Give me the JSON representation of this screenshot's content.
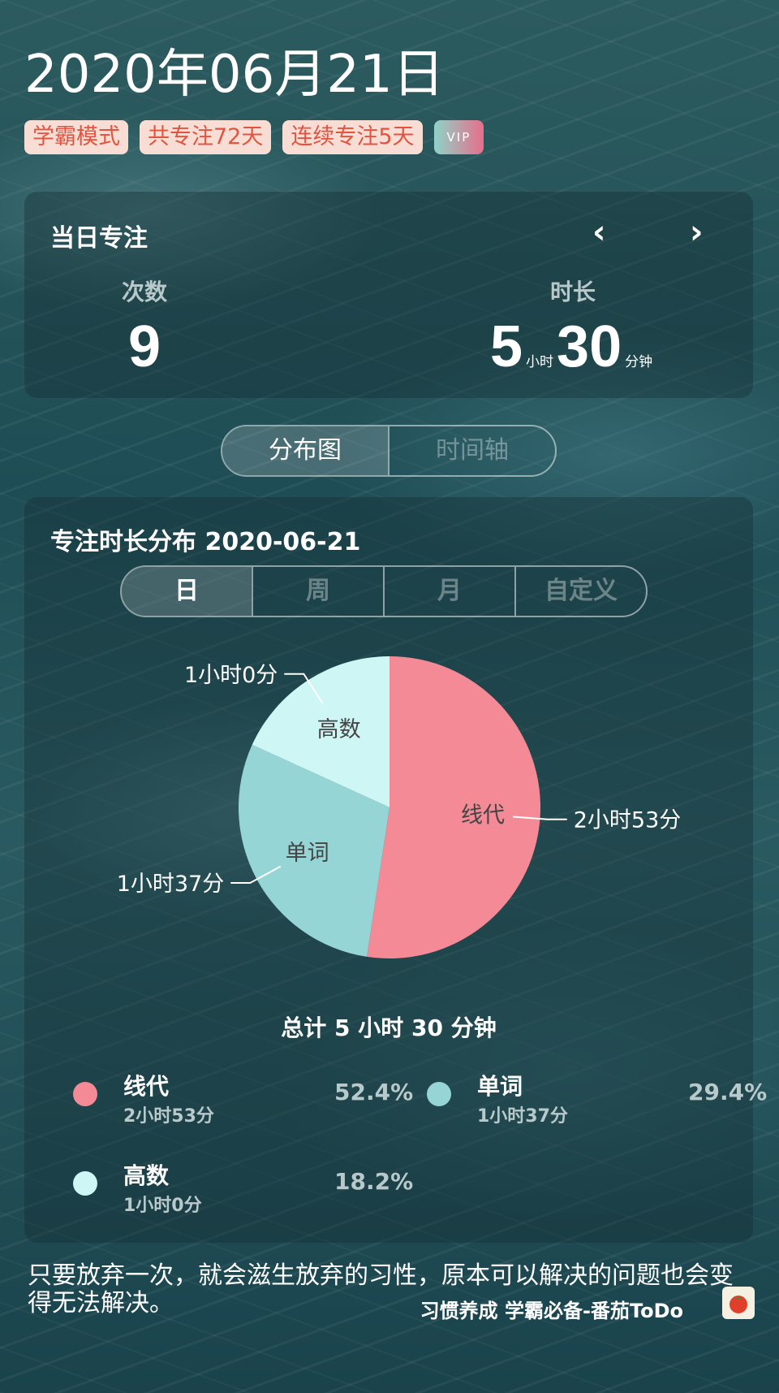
{
  "date_title": "2020年06月21日",
  "tags": [
    "学霸模式",
    "共专注72天",
    "连续专注5天"
  ],
  "vip_label": "VIP",
  "today": {
    "title": "当日专注",
    "count_label": "次数",
    "count_value": "9",
    "duration_label": "时长",
    "hours": "5",
    "hours_unit": "小时",
    "minutes": "30",
    "minutes_unit": "分钟"
  },
  "view_tabs": [
    "分布图",
    "时间轴"
  ],
  "chart_title": "专注时长分布  2020-06-21",
  "range_tabs": [
    "日",
    "周",
    "月",
    "自定义"
  ],
  "total_text": "总计 5 小时 30 分钟",
  "legend": [
    {
      "name": "线代",
      "duration": "2小时53分",
      "percent": "52.4%"
    },
    {
      "name": "单词",
      "duration": "1小时37分",
      "percent": "29.4%"
    },
    {
      "name": "高数",
      "duration": "1小时0分",
      "percent": "18.2%"
    }
  ],
  "chart_data": {
    "type": "pie",
    "title": "",
    "slices": [
      {
        "label": "线代",
        "value": 52.4,
        "value_label": "2小时53分",
        "color": "#f48a96"
      },
      {
        "label": "单词",
        "value": 29.4,
        "value_label": "1小时37分",
        "color": "#96d5d6"
      },
      {
        "label": "高数",
        "value": 18.2,
        "value_label": "1小时0分",
        "color": "#cdf6f4"
      }
    ]
  },
  "quote": "只要放弃一次，就会滋生放弃的习性，原本可以解决的问题也会变得无法解决。",
  "footer_text": "习惯养成 学霸必备-番茄ToDo",
  "colors": {
    "tag_bg": "#f8ddd5",
    "tag_text": "#e2543f"
  }
}
